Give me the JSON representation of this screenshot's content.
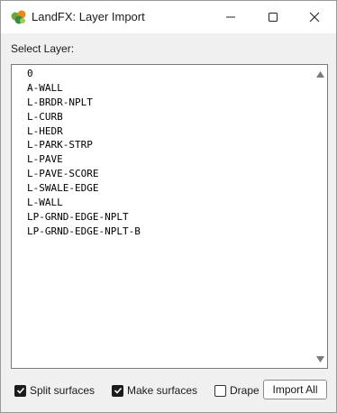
{
  "window": {
    "title": "LandFX: Layer Import",
    "icon": "landfx-logo-icon",
    "controls": [
      "minimize-icon",
      "maximize-icon",
      "close-icon"
    ]
  },
  "select_label": "Select Layer:",
  "layers": [
    "0",
    "A-WALL",
    "L-BRDR-NPLT",
    "L-CURB",
    "L-HEDR",
    "L-PARK-STRP",
    "L-PAVE",
    "L-PAVE-SCORE",
    "L-SWALE-EDGE",
    "L-WALL",
    "LP-GRND-EDGE-NPLT",
    "LP-GRND-EDGE-NPLT-B"
  ],
  "options": {
    "split_surfaces": {
      "label": "Split surfaces",
      "checked": true
    },
    "make_surfaces": {
      "label": "Make surfaces",
      "checked": true
    },
    "drape": {
      "label": "Drape",
      "checked": false
    }
  },
  "import_all_label": "Import All",
  "colors": {
    "accent_check": "#1c1c1c",
    "logo_green": "#6aaa3a",
    "logo_orange": "#e48a1e"
  }
}
